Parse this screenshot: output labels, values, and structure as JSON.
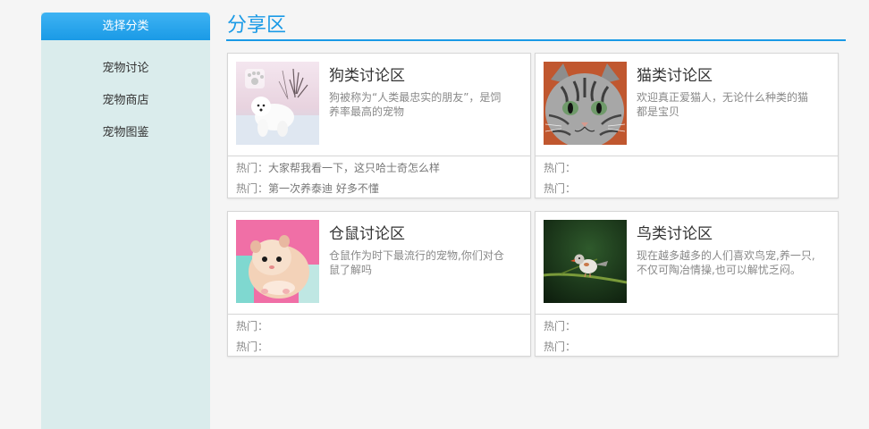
{
  "sidebar": {
    "header": "选择分类",
    "items": [
      {
        "label": "宠物讨论"
      },
      {
        "label": "宠物商店"
      },
      {
        "label": "宠物图鉴"
      }
    ]
  },
  "section": {
    "title": "分享区"
  },
  "cards": [
    {
      "title": "狗类讨论区",
      "desc": "狗被称为“人类最忠实的朋友”，是饲养率最高的宠物",
      "hot_label": "热门：",
      "hot": [
        "大家帮我看一下，这只哈士奇怎么样",
        "第一次养泰迪 好多不懂"
      ],
      "image": "samoyed-dog-photo"
    },
    {
      "title": "猫类讨论区",
      "desc": "欢迎真正爱猫人，无论什么种类的猫都是宝贝",
      "hot_label": "热门：",
      "hot": [
        "",
        ""
      ],
      "image": "tabby-cat-photo"
    },
    {
      "title": "仓鼠讨论区",
      "desc": "仓鼠作为时下最流行的宠物,你们对仓鼠了解吗",
      "hot_label": "热门：",
      "hot": [
        "",
        ""
      ],
      "image": "hamster-photo"
    },
    {
      "title": "鸟类讨论区",
      "desc": "现在越多越多的人们喜欢鸟宠,养一只,不仅可陶冶情操,也可以解忧乏闷。",
      "hot_label": "热门：",
      "hot": [
        "",
        ""
      ],
      "image": "finch-bird-photo"
    }
  ]
}
